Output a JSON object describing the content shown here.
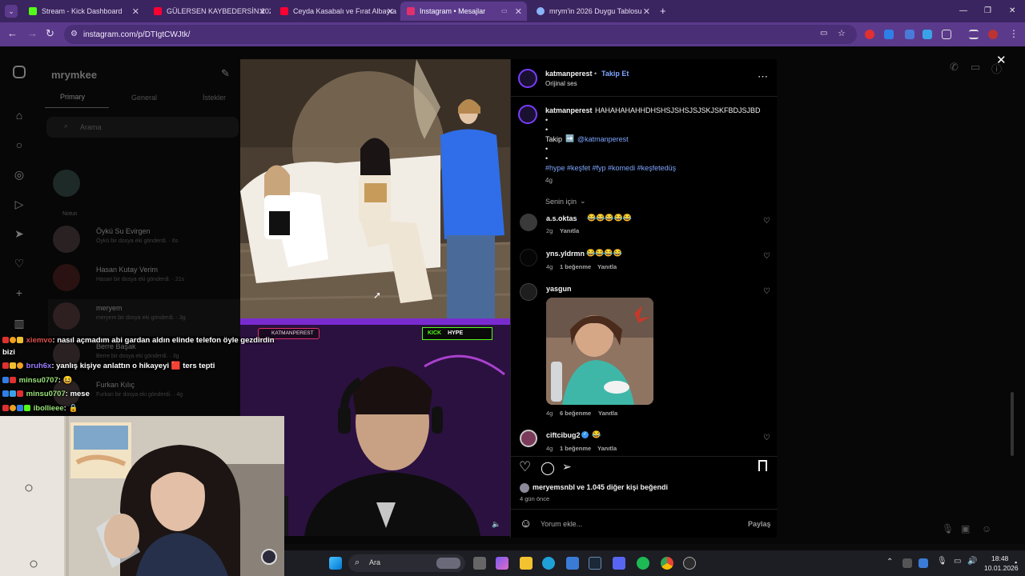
{
  "tabs": [
    {
      "label": "Stream - Kick Dashboard",
      "color": "#53fc18"
    },
    {
      "label": "GÜLERSEN KAYBEDERSİN 2026",
      "color": "#ff0033"
    },
    {
      "label": "Ceyda Kasabalı ve Fırat Albayra",
      "color": "#ff0033"
    },
    {
      "label": "Instagram • Mesajlar",
      "color": "#e1306c"
    },
    {
      "label": "mrym'in 2026 Duygu Tablosu",
      "color": "#8ab4f8"
    }
  ],
  "address": {
    "url": "instagram.com/p/DTIgtCWJtk/"
  },
  "inbox": {
    "username": "mrymkee",
    "tabs": [
      "Primary",
      "General",
      "İstekler"
    ],
    "search_placeholder": "Arama",
    "note_label": "Notun",
    "conversations": [
      {
        "name": "Öykü Su Evirgen",
        "sub": "Öykü bir dosya eki gönderdi. · 6s"
      },
      {
        "name": "Hasan Kutay Verim",
        "sub": "Hasan bir dosya eki gönderdi. · 21s"
      },
      {
        "name": "meryem",
        "sub": "meryem bir dosya eki gönderdi. · 3g"
      },
      {
        "name": "Berre Başak",
        "sub": "Berre bir dosya eki gönderdi. · 3g"
      },
      {
        "name": "Furkan Kılıç",
        "sub": "Furkan bir dosya eki gönderdi. · 4g"
      }
    ]
  },
  "video": {
    "overlay_handle": "KATMANPEREST",
    "kick_label": "KICK",
    "hype_label": "HYPE"
  },
  "post": {
    "author": "katmanperest",
    "follow_label": "Takip Et",
    "audio": "Orijinal ses",
    "caption_user": "katmanperest",
    "caption_text": "HAHAHAHAHHDHSHSJSHSJSJSKJSKFBDJSJBD",
    "caption_bullets": [
      "•",
      "•",
      "•",
      "•"
    ],
    "follow_line_prefix": "Takip",
    "follow_arrow": "➡️",
    "follow_mention": "@katmanperest",
    "hashtags": "#hype #keşfet #fyp #komedi #keşfetedüş",
    "caption_age": "4g",
    "sort_label": "Senin için",
    "comments": [
      {
        "user": "a.s.oktas",
        "text": "😂😂😂😂😂",
        "age": "2g",
        "likes": "",
        "reply": "Yanıtla",
        "avatar_color": "#3a3a3a"
      },
      {
        "user": "yns.yldrmn",
        "text": "😂😂😂😂",
        "age": "4g",
        "likes": "1 beğenme",
        "reply": "Yanıtla",
        "avatar_color": "#050505"
      },
      {
        "user": "yasgun",
        "text": "",
        "age": "4g",
        "likes": "6 beğenme",
        "reply": "Yanıtla",
        "avatar_color": "#2a2a2a"
      },
      {
        "user": "ciftcibug2",
        "text": "😂",
        "age": "4g",
        "likes": "1 beğenme",
        "reply": "Yanıtla",
        "avatar_color": "#7a3a5a"
      }
    ],
    "liked_by_user": "meryemsnbl",
    "liked_by_rest": "ve 1.045 diğer kişi beğendi",
    "post_age": "4 gün önce",
    "comment_placeholder": "Yorum ekle...",
    "share_label": "Paylaş"
  },
  "chat": [
    {
      "user": "xiemvo",
      "user_color": "#e05050",
      "text": ": nasıl açmadım abi gardan aldın elinde telefon öyle gezdirdin"
    },
    {
      "user": "",
      "user_color": "#ffffff",
      "text": "bizi"
    },
    {
      "user": "bruh6x",
      "user_color": "#9b7bff",
      "text": ": yanlış kişiye anlattın o hikayeyi 🟥 ters tepti"
    },
    {
      "user": "minsu0707",
      "user_color": "#9be37a",
      "text": ": 😆"
    },
    {
      "user": "minsu0707",
      "user_color": "#9be37a",
      "text": ": mese"
    },
    {
      "user": "ibollieee",
      "user_color": "#9be37a",
      "text": ": 🔒"
    }
  ],
  "taskbar": {
    "search_label": "Ara",
    "time": "18:48",
    "date": "10.01.2026"
  }
}
